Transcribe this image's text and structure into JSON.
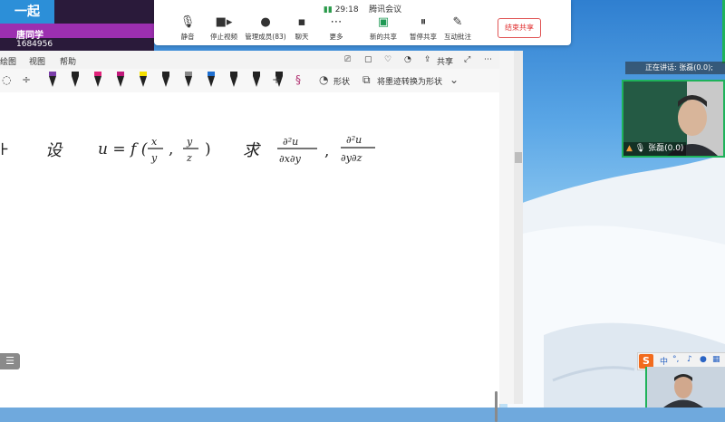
{
  "app_strip": {
    "logo_text": "一起",
    "badge": "唐同学",
    "id_number": "1684956"
  },
  "meeting": {
    "time": "29:18",
    "title": "腾讯会议",
    "items": [
      {
        "label": "静音",
        "icon": "microphone-icon"
      },
      {
        "label": "停止视频",
        "icon": "video-camera-icon"
      },
      {
        "label": "管理成员(83)",
        "icon": "people-icon"
      },
      {
        "label": "聊天",
        "icon": "chat-bubble-icon"
      },
      {
        "label": "更多",
        "icon": "more-icon"
      },
      {
        "label": "新的共享",
        "icon": "new-share-icon"
      },
      {
        "label": "暂停共享",
        "icon": "pause-share-icon"
      },
      {
        "label": "互动批注",
        "icon": "annotate-icon"
      }
    ],
    "end_share_label": "结束共享"
  },
  "speaker": {
    "now_speaking": "正在讲话: 张磊(0.0);",
    "video_name": "张磊(0.0)"
  },
  "notebook": {
    "menu": [
      "绘图",
      "视图",
      "帮助"
    ],
    "share_label": "共享",
    "shapes_label": "形状",
    "convert_label": "将墨迹转换为形状",
    "pen_colors": [
      "#7a3da8",
      "#222222",
      "#e0237a",
      "#c0197a",
      "#f5e000",
      "#222222",
      "#888888",
      "#1f6fd0",
      "#222222",
      "#222222",
      "#222222"
    ],
    "page_button": "☰"
  },
  "handwriting": {
    "given": "设",
    "function": "u = f ( x/y , y/z )",
    "ask": "求",
    "partial1": "∂²u / ∂x∂y",
    "sep": ",",
    "partial2": "∂²u / ∂y∂z"
  },
  "ime": {
    "logo": "S",
    "mode": "中"
  }
}
